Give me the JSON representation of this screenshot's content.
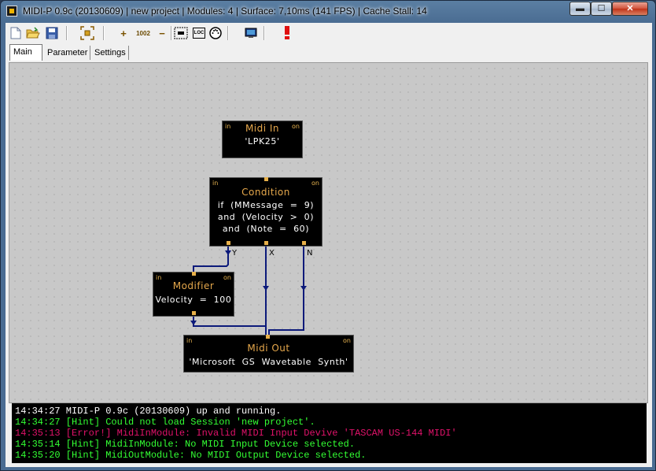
{
  "window": {
    "title": "MIDI-P 0.9c (20130609) | new project | Modules: 4 | Surface: 7,10ms (141 FPS) | Cache Stall: 14",
    "controls": {
      "minimize": "▬",
      "maximize": "☐",
      "close": "✕"
    }
  },
  "toolbar": {
    "buttons": [
      {
        "name": "new-file-icon"
      },
      {
        "name": "open-folder-icon"
      },
      {
        "name": "save-disk-icon"
      },
      {
        "name": "fit-view-icon"
      },
      {
        "name": "add-module-icon",
        "label": "+"
      },
      {
        "name": "zoom-value-icon",
        "label": "1002"
      },
      {
        "name": "remove-module-icon",
        "label": "−"
      },
      {
        "name": "select-area-icon"
      },
      {
        "name": "loc-icon",
        "label": "LOC"
      },
      {
        "name": "midi-port-icon"
      },
      {
        "name": "monitor-icon"
      },
      {
        "name": "alert-icon"
      }
    ]
  },
  "tabs": [
    {
      "label": "Main",
      "active": true
    },
    {
      "label": "Parameter",
      "active": false
    },
    {
      "label": "Settings",
      "active": false
    }
  ],
  "modules": {
    "midi_in": {
      "in": "in",
      "on": "on",
      "title": "Midi  In",
      "lines": [
        "'LPK25'"
      ]
    },
    "condition": {
      "in": "in",
      "on": "on",
      "title": "Condition",
      "lines": [
        "if  (MMessage  =  9)",
        "and  (Velocity  >  0)",
        "and  (Note  =  60)"
      ],
      "outputs": [
        "Y",
        "X",
        "N"
      ]
    },
    "modifier": {
      "in": "in",
      "on": "on",
      "title": "Modifier",
      "lines": [
        "Velocity  =  100"
      ]
    },
    "midi_out": {
      "in": "in",
      "on": "on",
      "title": "Midi  Out",
      "lines": [
        "'Microsoft  GS  Wavetable  Synth'"
      ]
    }
  },
  "console": {
    "lines": [
      {
        "text": "14:34:27 MIDI-P 0.9c (20130609) up and running.",
        "color": "#ffffff"
      },
      {
        "text": "14:34:27 [Hint] Could not load Session 'new project'.",
        "color": "#33ff33"
      },
      {
        "text": "14:35:13 [Error!] MidiInModule: Invalid MIDI Input Devive 'TASCAM US-144 MIDI'",
        "color": "#e0126a"
      },
      {
        "text": "14:35:14 [Hint] MidiInModule: No MIDI Input Device selected.",
        "color": "#33ff33"
      },
      {
        "text": "14:35:20 [Hint] MidiOutModule: No MIDI Output Device selected.",
        "color": "#33ff33"
      }
    ]
  },
  "colors": {
    "wire": "#0c1a7a",
    "module_title": "#e6a84c",
    "pin": "#e7b04a"
  }
}
